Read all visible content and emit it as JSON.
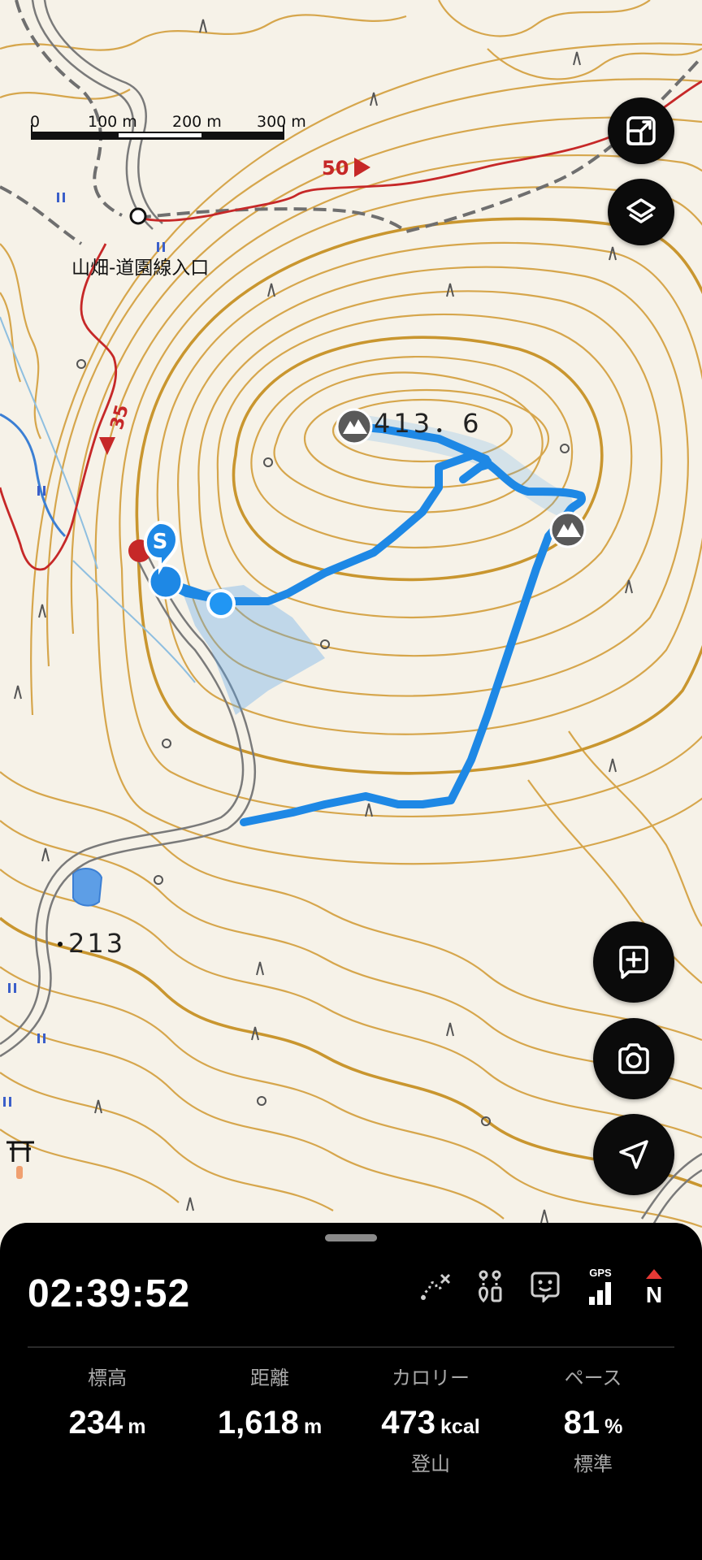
{
  "map": {
    "scale_labels": [
      "0",
      "100 m",
      "200 m",
      "300 m"
    ],
    "trailhead_label": "山畑-道園線入口",
    "peak_elevation_label": "413．6",
    "spot_height_label": "213",
    "route_number_labels": [
      "50",
      "35"
    ],
    "start_marker_label": "S"
  },
  "buttons": {
    "expand": "expand-icon",
    "layers": "layers-icon",
    "add_memo": "add-memo-icon",
    "camera": "camera-icon",
    "navigate": "navigation-arrow-icon"
  },
  "panel": {
    "timer": "02:39:52",
    "status_icons": [
      "route-off-icon",
      "waypoints-icon",
      "face-icon",
      "gps-signal-icon",
      "compass-north-icon"
    ],
    "gps_label": "GPS",
    "compass_label": "N",
    "stats": [
      {
        "label": "標高",
        "value": "234",
        "unit": "m",
        "sub": ""
      },
      {
        "label": "距離",
        "value": "1,618",
        "unit": "m",
        "sub": ""
      },
      {
        "label": "カロリー",
        "value": "473",
        "unit": "kcal",
        "sub": "登山"
      },
      {
        "label": "ペース",
        "value": "81",
        "unit": "%",
        "sub": "標準"
      }
    ]
  },
  "colors": {
    "contour": "#d4a54a",
    "track": "#1e88e5",
    "road_red": "#c62828",
    "panel_bg": "#000000"
  }
}
